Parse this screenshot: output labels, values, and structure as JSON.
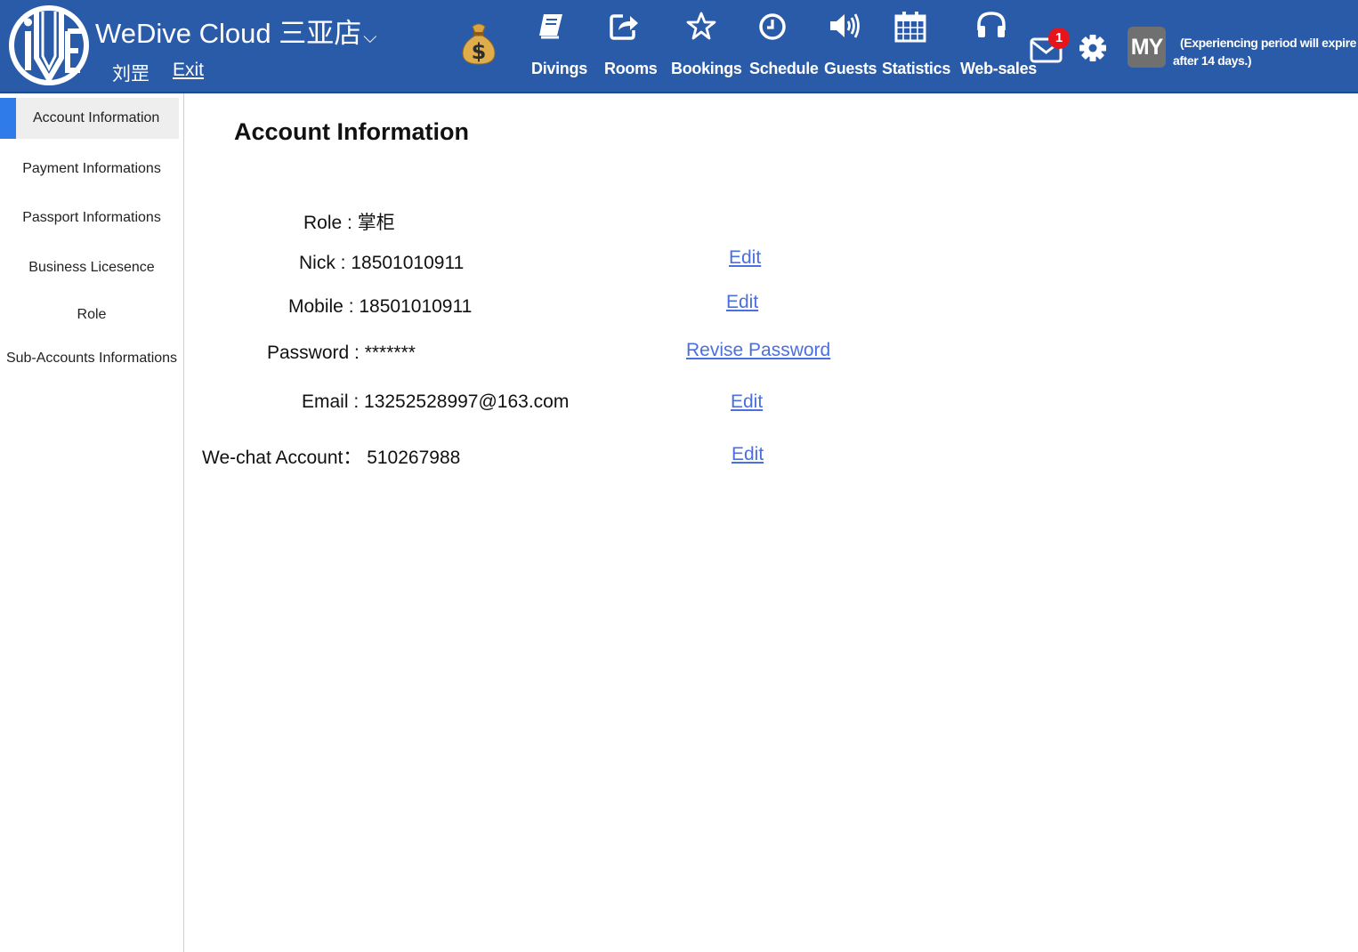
{
  "header": {
    "brand": "WeDive Cloud",
    "store": "三亚店",
    "user_name": "刘罡",
    "exit": "Exit",
    "nav": [
      {
        "label": "Divings",
        "icon": "book-icon"
      },
      {
        "label": "Rooms",
        "icon": "share-icon"
      },
      {
        "label": "Bookings",
        "icon": "star-icon"
      },
      {
        "label": "Schedule",
        "icon": "clock-icon"
      },
      {
        "label": "Guests",
        "icon": "volume-icon"
      },
      {
        "label": "Statistics",
        "icon": "calendar-icon"
      },
      {
        "label": "Web-sales",
        "icon": "headphones-icon"
      }
    ],
    "mail_badge": "1",
    "avatar": "MY",
    "expire_line1": "(Experiencing period will expire",
    "expire_line2": "after 14 days.)",
    "colors": {
      "header_bg": "#2a5ba8",
      "badge": "#e8141b",
      "accent": "#2f7bea",
      "link": "#4a6fe0"
    }
  },
  "sidebar": {
    "items": [
      {
        "label": "Account Information",
        "active": true
      },
      {
        "label": "Payment Informations"
      },
      {
        "label": "Passport Informations"
      },
      {
        "label": "Business Licesence"
      },
      {
        "label": "Role"
      },
      {
        "label": "Sub-Accounts Informations"
      }
    ]
  },
  "main": {
    "title": "Account Information",
    "role": "Role : 掌柜",
    "nick": "Nick : 18501010911",
    "mobile": "Mobile : 18501010911",
    "password": "Password : *******",
    "email": "Email : 13252528997@163.com",
    "wechat": "We-chat Account：  510267988",
    "edit": "Edit",
    "revise_password": "Revise Password"
  }
}
